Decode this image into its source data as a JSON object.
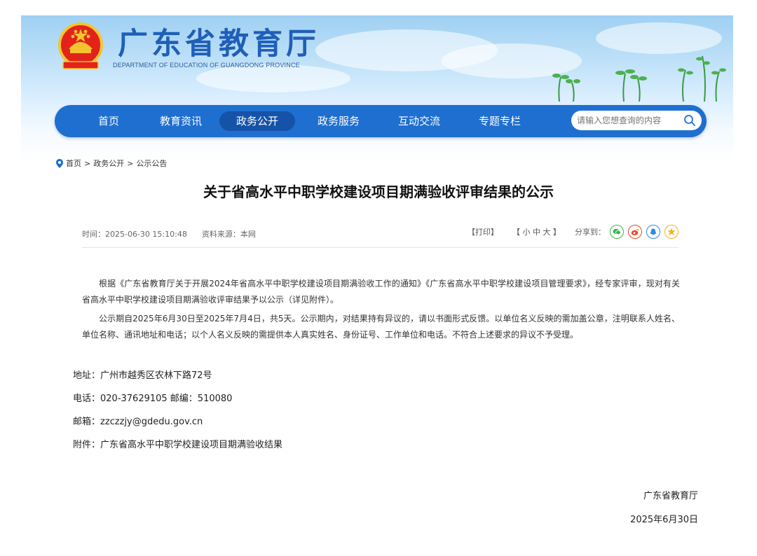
{
  "header": {
    "title": "广东省教育厅",
    "subtitle": "DEPARTMENT OF EDUCATION OF GUANGDONG PROVINCE",
    "emblem_icon": "national-emblem-icon"
  },
  "nav": {
    "items": [
      {
        "label": "首页"
      },
      {
        "label": "教育资讯"
      },
      {
        "label": "政务公开"
      },
      {
        "label": "政务服务"
      },
      {
        "label": "互动交流"
      },
      {
        "label": "专题专栏"
      }
    ],
    "active_index": 2,
    "search_placeholder": "请输入您想查询的内容",
    "search_icon": "search-icon"
  },
  "breadcrumb": {
    "home": "首页",
    "sep": ">",
    "section": "政务公开",
    "current": "公示公告"
  },
  "article": {
    "title": "关于省高水平中职学校建设项目期满验收评审结果的公示",
    "time": "时间：2025-06-30 15:10:48",
    "source": "资料来源：本网",
    "print": "【打印】",
    "font_sizes": "【 小  中  大 】",
    "share_label": "分享到：",
    "share_icons": [
      "wechat-icon",
      "weibo-icon",
      "qq-icon",
      "qzone-icon"
    ],
    "paragraphs": [
      "根据《广东省教育厅关于开展2024年省高水平中职学校建设项目期满验收工作的通知》《广东省高水平中职学校建设项目管理要求》，经专家评审，现对有关省高水平中职学校建设项目期满验收评审结果予以公示（详见附件）。",
      "公示期自2025年6月30日至2025年7月4日，共5天。公示期内，对结果持有异议的，请以书面形式反馈。以单位名义反映的需加盖公章，注明联系人姓名、单位名称、通讯地址和电话；以个人名义反映的需提供本人真实姓名、身份证号、工作单位和电话。不符合上述要求的异议不予受理。"
    ],
    "address": "地址：广州市越秀区农林下路72号",
    "phone": "电话：020-37629105  邮编：510080",
    "email": "邮箱：zzczzjy@gdedu.gov.cn",
    "attachment_label": "附件：",
    "attachment": "广东省高水平中职学校建设项目期满验收结果",
    "sign_org": "广东省教育厅",
    "sign_date": "2025年6月30日"
  },
  "colors": {
    "nav_bg": "#1e6fd0",
    "nav_active": "#1553a8",
    "title_blue": "#1f5fb8"
  }
}
